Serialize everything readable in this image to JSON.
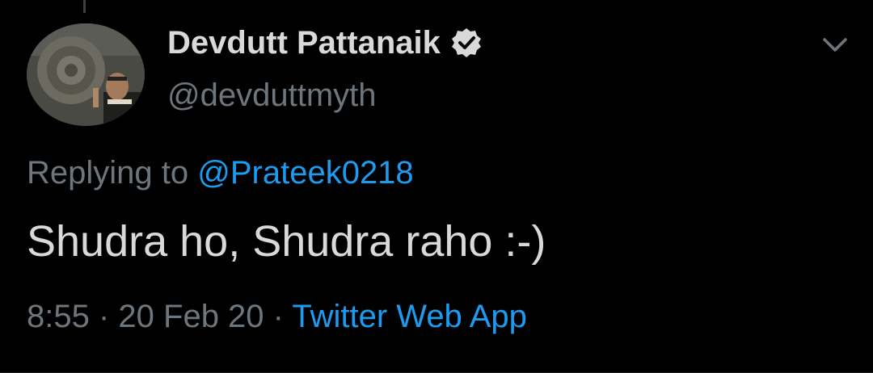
{
  "tweet": {
    "author": {
      "display_name": "Devdutt Pattanaik",
      "handle": "@devduttmyth",
      "verified": true
    },
    "reply": {
      "prefix": "Replying to ",
      "mention": "@Prateek0218"
    },
    "text": "Shudra ho, Shudra raho :-)",
    "meta": {
      "time": "8:55",
      "separator1": " · ",
      "date": "20 Feb 20",
      "separator2": " · ",
      "source": "Twitter Web App"
    }
  },
  "icons": {
    "verified": "verified-badge-icon",
    "menu": "chevron-down-icon"
  },
  "colors": {
    "background": "#000000",
    "primary_text": "#d9d9d9",
    "secondary_text": "#6e767d",
    "link": "#1d9bf0"
  }
}
